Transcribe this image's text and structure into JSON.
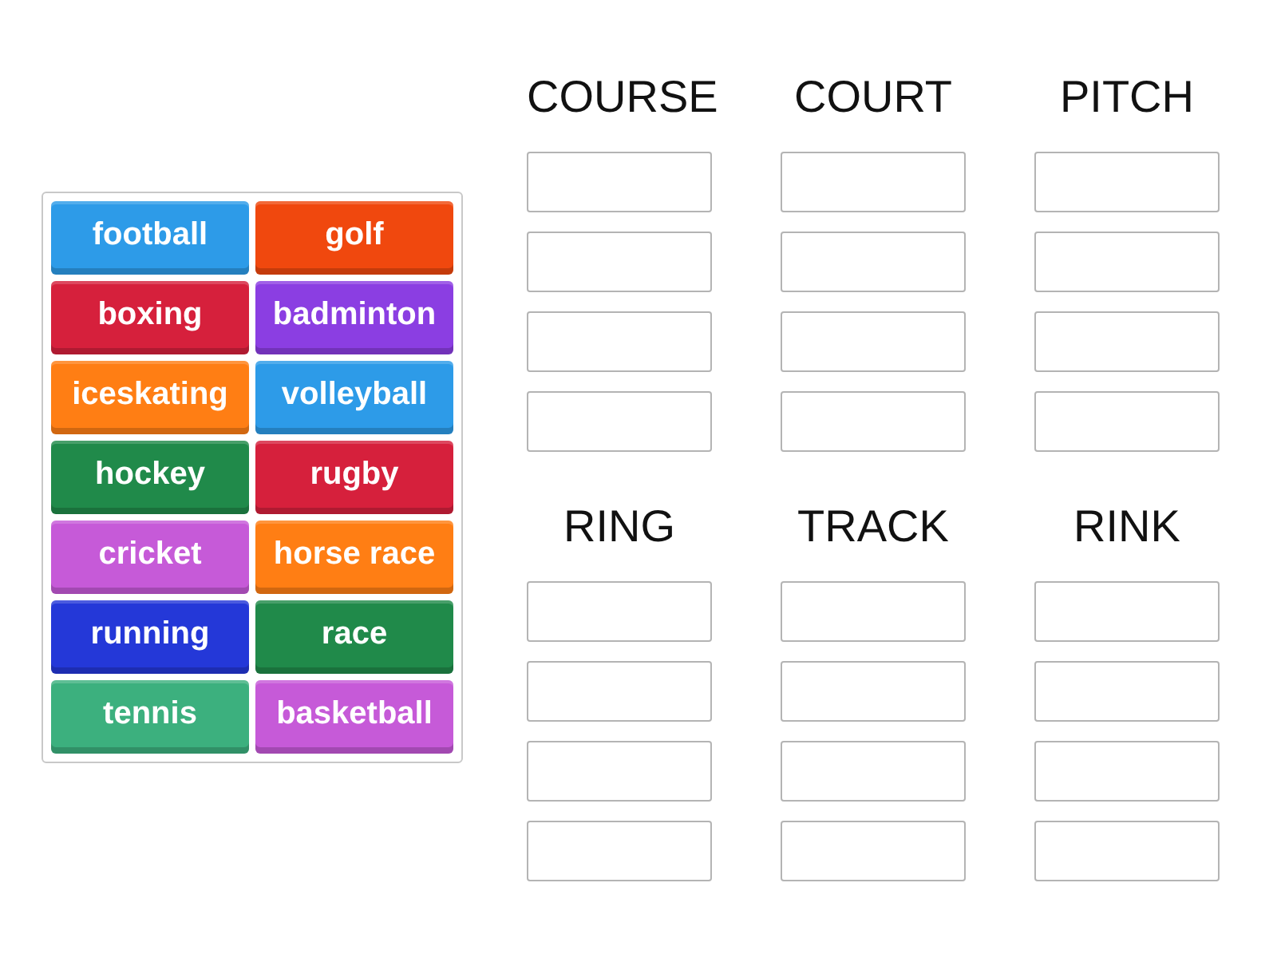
{
  "tiles": [
    {
      "label": "football",
      "color": "#2d9be8"
    },
    {
      "label": "golf",
      "color": "#f0480e"
    },
    {
      "label": "boxing",
      "color": "#d6203c"
    },
    {
      "label": "badminton",
      "color": "#8b3ee2"
    },
    {
      "label": "iceskating",
      "color": "#ff7e14"
    },
    {
      "label": "volleyball",
      "color": "#2d9be8"
    },
    {
      "label": "hockey",
      "color": "#208a4a"
    },
    {
      "label": "rugby",
      "color": "#d6203c"
    },
    {
      "label": "cricket",
      "color": "#c65ad8"
    },
    {
      "label": "horse race",
      "color": "#ff7e14"
    },
    {
      "label": "running",
      "color": "#2438d8"
    },
    {
      "label": "race",
      "color": "#208a4a"
    },
    {
      "label": "tennis",
      "color": "#3cb07e"
    },
    {
      "label": "basketball",
      "color": "#c65ad8"
    }
  ],
  "groups": [
    {
      "heading": "COURSE",
      "slots": [
        {
          "kind": "blank"
        },
        {
          "kind": "blank"
        },
        {
          "kind": "blank"
        },
        {
          "kind": "blank"
        }
      ]
    },
    {
      "heading": "COURT",
      "slots": [
        {
          "kind": "blank"
        },
        {
          "kind": "blank"
        },
        {
          "kind": "blank"
        },
        {
          "kind": "blank"
        }
      ]
    },
    {
      "heading": "PITCH",
      "slots": [
        {
          "kind": "blank"
        },
        {
          "kind": "blank"
        },
        {
          "kind": "blank"
        },
        {
          "kind": "blank"
        }
      ]
    },
    {
      "heading": "RING",
      "slots": [
        {
          "kind": "blank"
        },
        {
          "kind": "blank"
        },
        {
          "kind": "blank"
        },
        {
          "kind": "blank"
        }
      ]
    },
    {
      "heading": "TRACK",
      "slots": [
        {
          "kind": "blank"
        },
        {
          "kind": "blank"
        },
        {
          "kind": "blank"
        },
        {
          "kind": "blank"
        }
      ]
    },
    {
      "heading": "RINK",
      "slots": [
        {
          "kind": "blank"
        },
        {
          "kind": "blank"
        },
        {
          "kind": "blank"
        },
        {
          "kind": "blank"
        }
      ]
    }
  ]
}
